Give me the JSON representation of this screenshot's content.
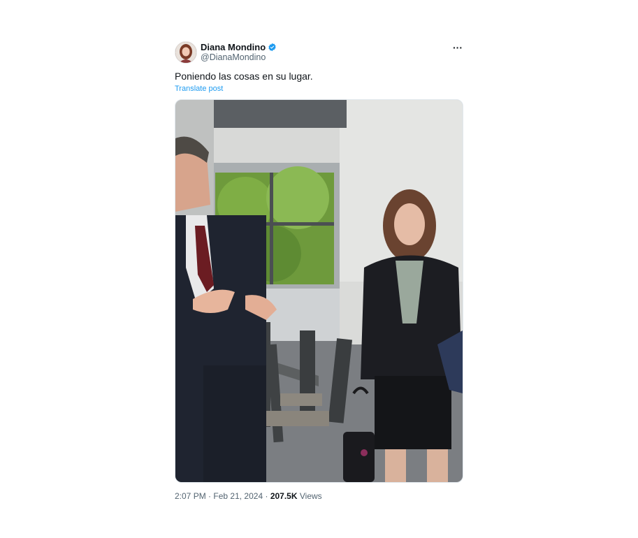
{
  "author": {
    "name": "Diana Mondino",
    "handle": "@DianaMondino",
    "verified": true,
    "verified_color": "#1d9bf0",
    "avatar_icon": "profile-avatar"
  },
  "more_icon": "ellipsis-icon",
  "more_label": "···",
  "post": {
    "text": "Poniendo las cosas en su lugar.",
    "translate_label": "Translate post"
  },
  "media": {
    "type": "photo",
    "icon": "photo"
  },
  "meta": {
    "time": "2:07 PM",
    "separator": "·",
    "date": "Feb 21, 2024",
    "views_count": "207.5K",
    "views_label": "Views"
  },
  "colors": {
    "text": "#0f1419",
    "secondary": "#536471",
    "link": "#1d9bf0"
  }
}
